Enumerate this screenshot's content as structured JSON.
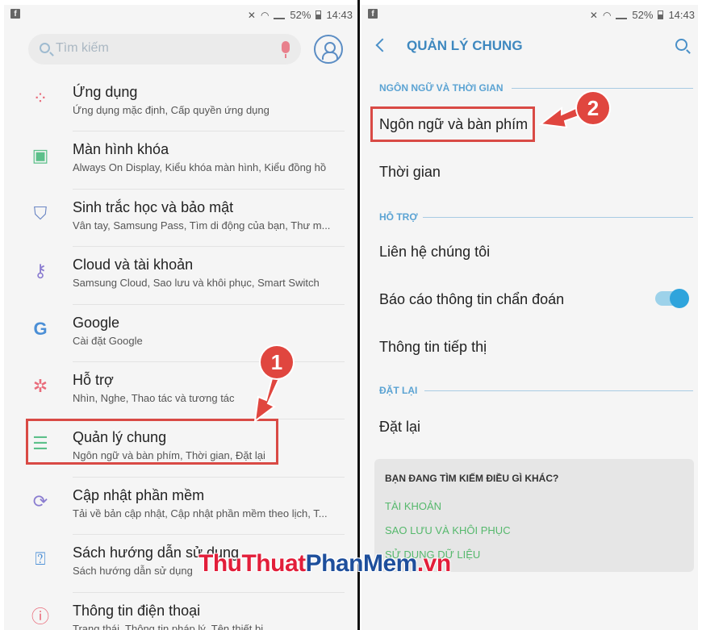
{
  "status_bar": {
    "battery": "52%",
    "time": "14:43"
  },
  "left": {
    "search_placeholder": "Tìm kiếm",
    "items": [
      {
        "title": "Ứng dụng",
        "subtitle": "Ứng dụng mặc định, Cấp quyền ứng dụng",
        "icon": "apps-icon",
        "color": "#e96b7a"
      },
      {
        "title": "Màn hình khóa",
        "subtitle": "Always On Display, Kiểu khóa màn hình, Kiểu đồng hồ",
        "icon": "lock-icon",
        "color": "#5cc08a"
      },
      {
        "title": "Sinh trắc học và bảo mật",
        "subtitle": "Vân tay, Samsung Pass, Tìm di động của bạn, Thư m...",
        "icon": "shield-icon",
        "color": "#6a86c4"
      },
      {
        "title": "Cloud và tài khoản",
        "subtitle": "Samsung Cloud, Sao lưu và khôi phục, Smart Switch",
        "icon": "key-icon",
        "color": "#8a7cd0"
      },
      {
        "title": "Google",
        "subtitle": "Cài đặt Google",
        "icon": "google-icon",
        "color": "#4b8fd6"
      },
      {
        "title": "Hỗ trợ",
        "subtitle": "Nhìn, Nghe, Thao tác và tương tác",
        "icon": "accessibility-icon",
        "color": "#e96b7a"
      },
      {
        "title": "Quản lý chung",
        "subtitle": "Ngôn ngữ và bàn phím, Thời gian, Đặt lại",
        "icon": "sliders-icon",
        "color": "#5cc08a"
      },
      {
        "title": "Cập nhật phần mềm",
        "subtitle": "Tải về bản cập nhật, Cập nhật phần mềm theo lịch, T...",
        "icon": "update-icon",
        "color": "#8a7cd0"
      },
      {
        "title": "Sách hướng dẫn sử dụng",
        "subtitle": "Sách hướng dẫn sử dụng",
        "icon": "help-icon",
        "color": "#4b8fd6"
      },
      {
        "title": "Thông tin điện thoại",
        "subtitle": "Trạng thái, Thông tin pháp lý, Tên thiết bị",
        "icon": "info-icon",
        "color": "#e96b7a"
      }
    ],
    "step_badge": "1"
  },
  "right": {
    "header_title": "QUẢN LÝ CHUNG",
    "section_language": "NGÔN NGỮ VÀ THỜI GIAN",
    "item_language": "Ngôn ngữ và bàn phím",
    "item_time": "Thời gian",
    "section_support": "HỖ TRỢ",
    "item_contact": "Liên hệ chúng tôi",
    "item_diagnostics": "Báo cáo thông tin chẩn đoán",
    "item_marketing": "Thông tin tiếp thị",
    "section_reset": "ĐẶT LẠI",
    "item_reset": "Đặt lại",
    "card_title": "BẠN ĐANG TÌM KIẾM ĐIỀU GÌ KHÁC?",
    "card_links": [
      "TÀI KHOẢN",
      "SAO LƯU VÀ KHÔI PHỤC",
      "SỬ DỤNG DỮ LIỆU"
    ],
    "step_badge": "2",
    "diagnostics_toggle_on": true
  },
  "watermark": {
    "part1": "ThuThuat",
    "part2": "PhanMem",
    "part3": ".vn"
  },
  "colors": {
    "accent": "#3e88bf",
    "highlight_box": "#d94a45",
    "link_green": "#55b86c"
  }
}
